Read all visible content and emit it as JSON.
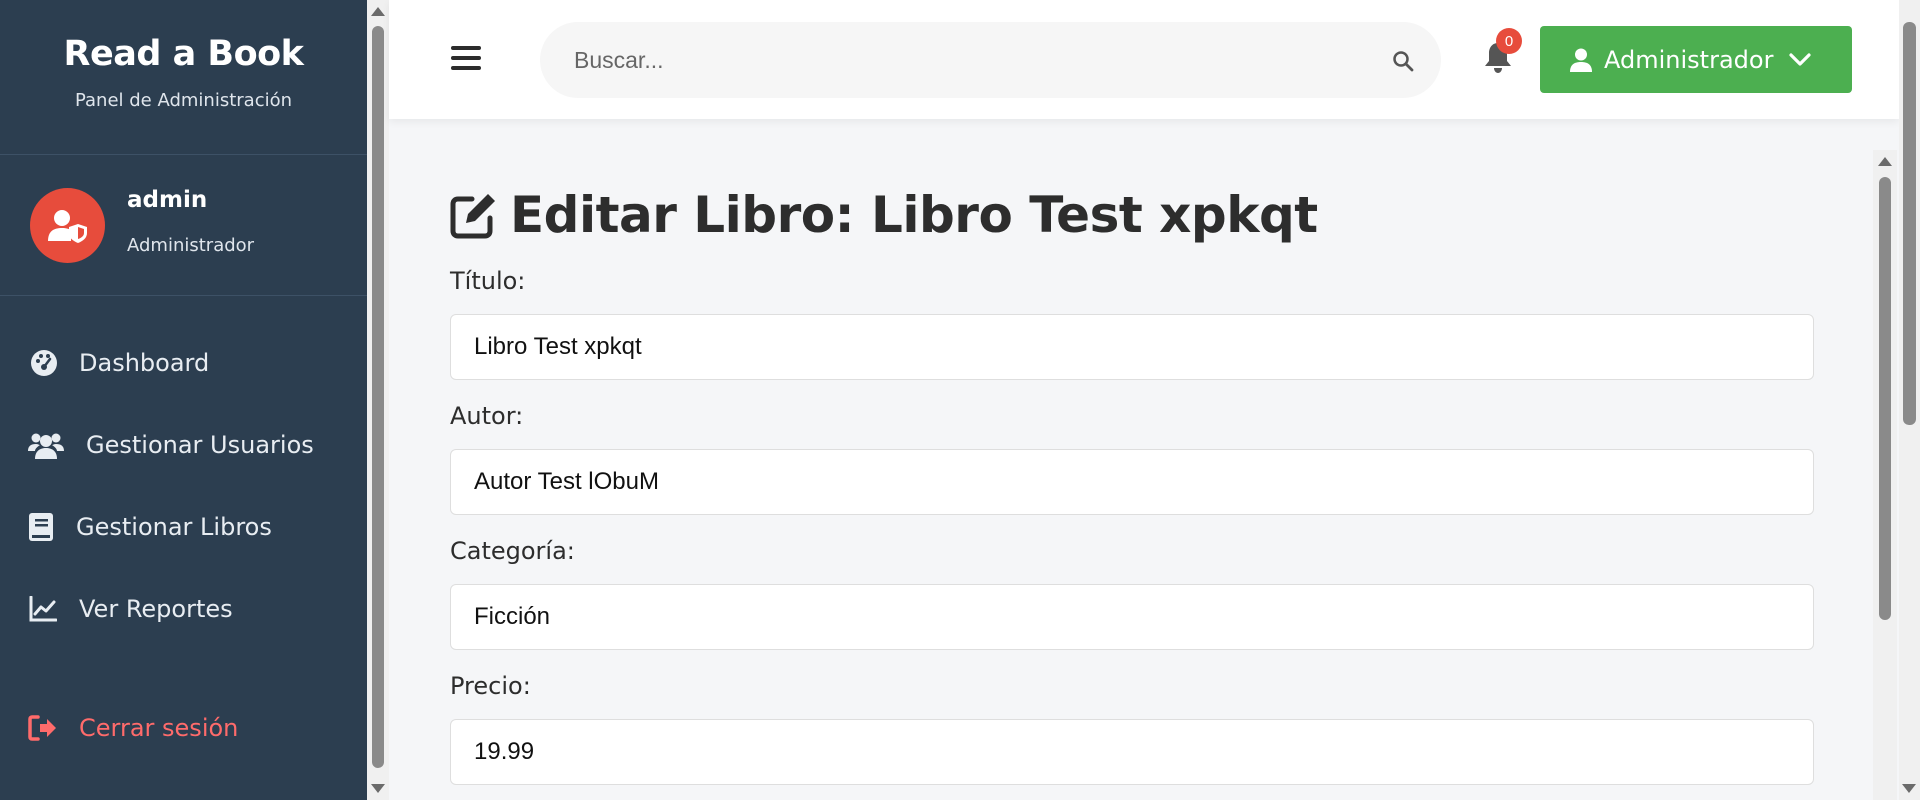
{
  "sidebar": {
    "brand_title": "Read a Book",
    "brand_subtitle": "Panel de Administración",
    "user": {
      "name": "admin",
      "role": "Administrador"
    },
    "nav": [
      {
        "label": "Dashboard",
        "icon": "dashboard-gauge-icon"
      },
      {
        "label": "Gestionar Usuarios",
        "icon": "users-icon"
      },
      {
        "label": "Gestionar Libros",
        "icon": "book-icon"
      },
      {
        "label": "Ver Reportes",
        "icon": "chart-line-icon"
      }
    ],
    "logout_label": "Cerrar sesión"
  },
  "header": {
    "search_placeholder": "Buscar...",
    "notification_count": "0",
    "user_button_label": "Administrador"
  },
  "main": {
    "title": "Editar Libro: Libro Test xpkqt",
    "fields": [
      {
        "label": "Título:",
        "value": "Libro Test xpkqt"
      },
      {
        "label": "Autor:",
        "value": "Autor Test lObuM"
      },
      {
        "label": "Categoría:",
        "value": "Ficción"
      },
      {
        "label": "Precio:",
        "value": "19.99"
      }
    ]
  },
  "colors": {
    "sidebar_bg": "#2c3e50",
    "accent_green": "#4caf50",
    "danger_red": "#e74c3c",
    "logout_red": "#ff6b6b"
  }
}
